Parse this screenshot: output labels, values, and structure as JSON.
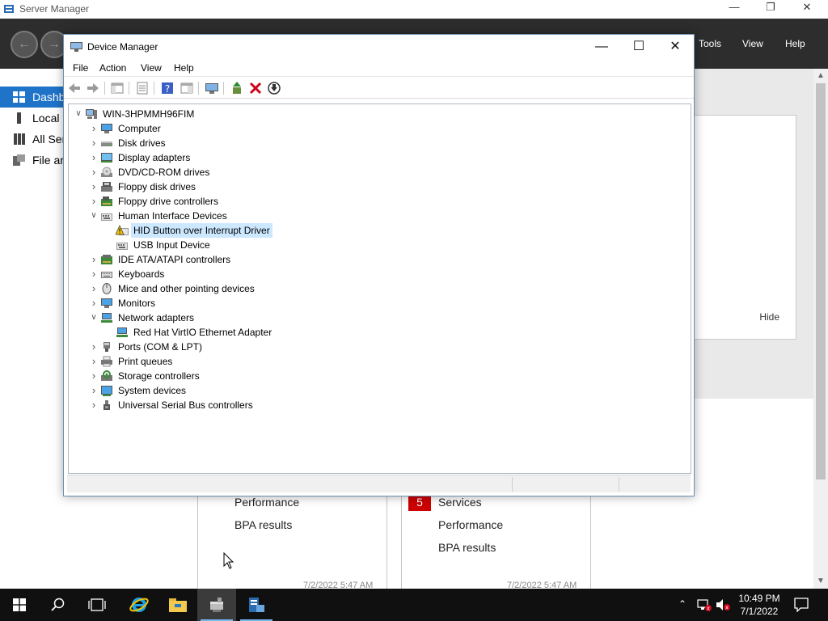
{
  "server_manager": {
    "title": "Server Manager",
    "menu": [
      "Tools",
      "View",
      "Help"
    ],
    "sidebar": [
      {
        "label": "Dashb",
        "active": true
      },
      {
        "label": "Local S",
        "active": false
      },
      {
        "label": "All Ser",
        "active": false
      },
      {
        "label": "File an",
        "active": false
      }
    ],
    "hide_label": "Hide",
    "card_left": {
      "lines": [
        "Performance",
        "BPA results"
      ],
      "date": "7/2/2022 5:47 AM"
    },
    "card_right": {
      "badge": "5",
      "lines": [
        "Services",
        "Performance",
        "BPA results"
      ],
      "date": "7/2/2022 5:47 AM"
    }
  },
  "device_manager": {
    "title": "Device Manager",
    "menu": [
      "File",
      "Action",
      "View",
      "Help"
    ],
    "tree": [
      {
        "label": "WIN-3HPMMH96FIM",
        "level": 0,
        "expanded": true,
        "icon": "computer-root-icon"
      },
      {
        "label": "Computer",
        "level": 1,
        "expanded": false,
        "icon": "computer-icon"
      },
      {
        "label": "Disk drives",
        "level": 1,
        "expanded": false,
        "icon": "disk-drive-icon"
      },
      {
        "label": "Display adapters",
        "level": 1,
        "expanded": false,
        "icon": "display-adapter-icon"
      },
      {
        "label": "DVD/CD-ROM drives",
        "level": 1,
        "expanded": false,
        "icon": "dvd-drive-icon"
      },
      {
        "label": "Floppy disk drives",
        "level": 1,
        "expanded": false,
        "icon": "floppy-disk-icon"
      },
      {
        "label": "Floppy drive controllers",
        "level": 1,
        "expanded": false,
        "icon": "floppy-controller-icon"
      },
      {
        "label": "Human Interface Devices",
        "level": 1,
        "expanded": true,
        "icon": "hid-icon"
      },
      {
        "label": "HID Button over Interrupt Driver",
        "level": 2,
        "selected": true,
        "icon": "hid-warning-icon"
      },
      {
        "label": "USB Input Device",
        "level": 2,
        "icon": "hid-icon"
      },
      {
        "label": "IDE ATA/ATAPI controllers",
        "level": 1,
        "expanded": false,
        "icon": "ide-controller-icon"
      },
      {
        "label": "Keyboards",
        "level": 1,
        "expanded": false,
        "icon": "keyboard-icon"
      },
      {
        "label": "Mice and other pointing devices",
        "level": 1,
        "expanded": false,
        "icon": "mouse-icon"
      },
      {
        "label": "Monitors",
        "level": 1,
        "expanded": false,
        "icon": "monitor-icon"
      },
      {
        "label": "Network adapters",
        "level": 1,
        "expanded": true,
        "icon": "network-adapter-icon"
      },
      {
        "label": "Red Hat VirtIO Ethernet Adapter",
        "level": 2,
        "icon": "network-adapter-icon"
      },
      {
        "label": "Ports (COM & LPT)",
        "level": 1,
        "expanded": false,
        "icon": "port-icon"
      },
      {
        "label": "Print queues",
        "level": 1,
        "expanded": false,
        "icon": "printer-icon"
      },
      {
        "label": "Storage controllers",
        "level": 1,
        "expanded": false,
        "icon": "storage-controller-icon"
      },
      {
        "label": "System devices",
        "level": 1,
        "expanded": false,
        "icon": "system-device-icon"
      },
      {
        "label": "Universal Serial Bus controllers",
        "level": 1,
        "expanded": false,
        "icon": "usb-icon"
      }
    ]
  },
  "taskbar": {
    "time": "10:49 PM",
    "date": "7/1/2022"
  },
  "colors": {
    "accent": "#1f74c9",
    "header": "#2d2d2d",
    "selection": "#cce8ff",
    "badge": "#cc0000",
    "taskbar": "#101010"
  }
}
